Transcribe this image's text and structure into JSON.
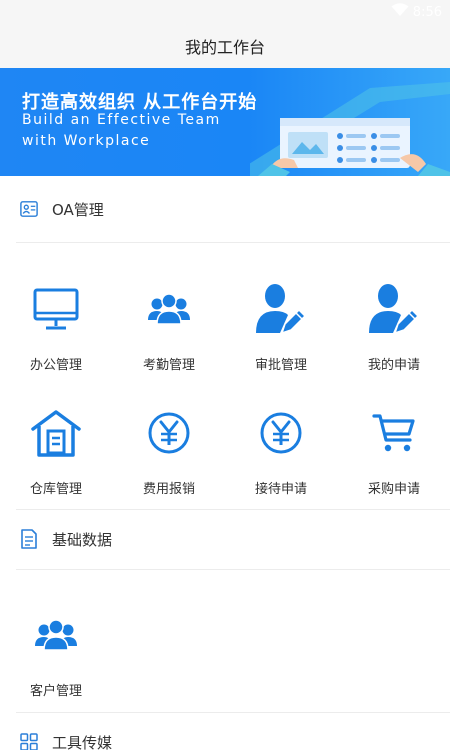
{
  "status": {
    "time": "8:56"
  },
  "header": {
    "title": "我的工作台"
  },
  "banner": {
    "line1": "打造高效组织 从工作台开始",
    "line2": "Build an Effective Team",
    "line3": "with Workplace"
  },
  "sections": [
    {
      "title": "OA管理",
      "items": [
        {
          "label": "办公管理",
          "icon": "monitor-icon"
        },
        {
          "label": "考勤管理",
          "icon": "group-icon"
        },
        {
          "label": "审批管理",
          "icon": "user-edit-icon"
        },
        {
          "label": "我的申请",
          "icon": "user-edit-icon"
        },
        {
          "label": "仓库管理",
          "icon": "warehouse-icon"
        },
        {
          "label": "费用报销",
          "icon": "yen-circle-icon"
        },
        {
          "label": "接待申请",
          "icon": "yen-circle-icon"
        },
        {
          "label": "采购申请",
          "icon": "cart-icon"
        }
      ]
    },
    {
      "title": "基础数据",
      "items": [
        {
          "label": "客户管理",
          "icon": "group-icon"
        }
      ]
    },
    {
      "title": "工具传媒",
      "items": []
    }
  ],
  "colors": {
    "accent": "#1a7ee0",
    "banner": "#1f86f4",
    "bar": "#f6f6f6"
  }
}
